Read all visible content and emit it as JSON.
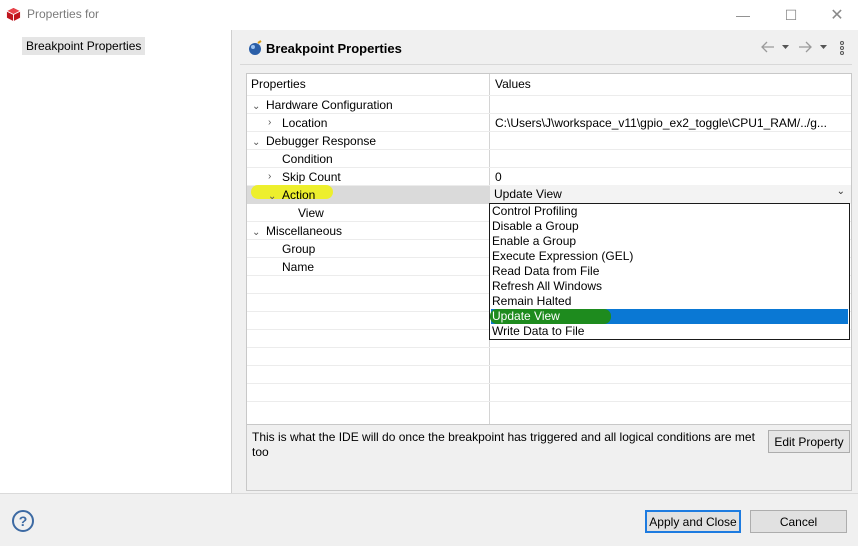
{
  "window": {
    "title": "Properties for",
    "minimize_glyph": "—",
    "maximize_glyph": "☐",
    "close_glyph": "✕"
  },
  "nav": {
    "items": [
      {
        "label": "Breakpoint Properties"
      }
    ]
  },
  "page": {
    "title": "Breakpoint Properties",
    "nav_icons": [
      "back-arrow-icon",
      "back-dropdown-icon",
      "forward-arrow-icon",
      "forward-dropdown-icon",
      "view-menu-icon"
    ]
  },
  "table": {
    "headers": {
      "properties": "Properties",
      "values": "Values"
    },
    "rows": [
      {
        "label": "Hardware Configuration",
        "value": ""
      },
      {
        "label": "Location",
        "value": "C:\\Users\\J\\workspace_v11\\gpio_ex2_toggle\\CPU1_RAM/../g..."
      },
      {
        "label": "Debugger Response",
        "value": ""
      },
      {
        "label": "Condition",
        "value": ""
      },
      {
        "label": "Skip Count",
        "value": "0"
      },
      {
        "label": "Action",
        "value": "Update View"
      },
      {
        "label": "View",
        "value": ""
      },
      {
        "label": "Miscellaneous",
        "value": ""
      },
      {
        "label": "Group",
        "value": ""
      },
      {
        "label": "Name",
        "value": ""
      }
    ]
  },
  "action_dropdown": {
    "selected": "Update View",
    "options": [
      "Control Profiling",
      "Disable a Group",
      "Enable a Group",
      "Execute Expression (GEL)",
      "Read Data from File",
      "Refresh All Windows",
      "Remain Halted",
      "Update View",
      "Write Data to File"
    ]
  },
  "description": {
    "text": "This is what the IDE will do once the breakpoint has triggered and all logical conditions are met too",
    "edit_button": "Edit Property"
  },
  "footer": {
    "help_glyph": "?",
    "apply_label": "Apply and Close",
    "cancel_label": "Cancel"
  },
  "colors": {
    "selection_blue": "#0a78d4",
    "highlight_yellow": "#eef11a",
    "highlight_green": "#1e8b1e",
    "default_button_border": "#1d7be0"
  }
}
